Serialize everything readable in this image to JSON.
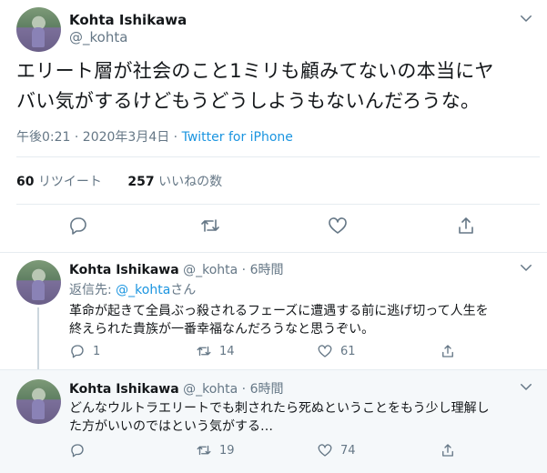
{
  "tweet": {
    "name": "Kohta Ishikawa",
    "handle": "@_kohta",
    "text_line1": "エリート層が社会のこと1ミリも顧みてないの本当にヤ",
    "text_line2": "バい気がするけどもうどうしようもないんだろうな。",
    "time": "午後0:21 · 2020年3月4日 · ",
    "source": "Twitter for iPhone",
    "retweet_count": "60",
    "retweet_label": "リツイート",
    "like_count": "257",
    "like_label": "いいねの数"
  },
  "replies": [
    {
      "name": "Kohta Ishikawa",
      "handle_time": "@_kohta · 6時間",
      "reply_to_label": "返信先: ",
      "reply_to_handle": "@_kohta",
      "reply_to_suffix": "さん",
      "text_line1": "革命が起きて全員ぶっ殺されるフェーズに遭遇する前に逃げ切って人生を",
      "text_line2": "終えられた貴族が一番幸福なんだろうなと思うぞい。",
      "replies": "1",
      "retweets": "14",
      "likes": "61"
    },
    {
      "name": "Kohta Ishikawa",
      "handle_time": "@_kohta · 6時間",
      "text_line1": "どんなウルトラエリートでも刺されたら死ぬということをもう少し理解し",
      "text_line2": "た方がいいのではという気がする…",
      "replies": "",
      "retweets": "19",
      "likes": "74"
    }
  ],
  "icons": {
    "reply": "reply-icon",
    "retweet": "retweet-icon",
    "like": "heart-icon",
    "share": "share-icon",
    "menu": "chevron-down-icon"
  },
  "colors": {
    "link": "#1b95e0",
    "secondary": "#657786",
    "divider": "#e6ecf0"
  }
}
